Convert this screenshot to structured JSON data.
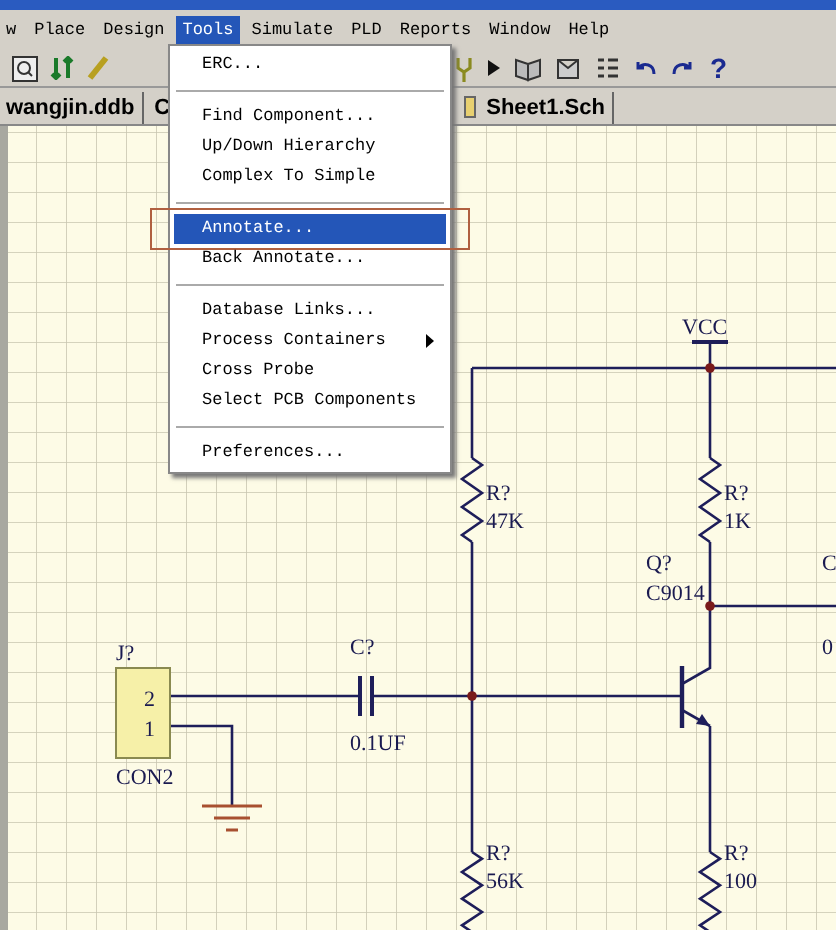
{
  "menubar": [
    {
      "label": "w",
      "selected": false
    },
    {
      "label": "Place",
      "selected": false
    },
    {
      "label": "Design",
      "selected": false
    },
    {
      "label": "Tools",
      "selected": true
    },
    {
      "label": "Simulate",
      "selected": false
    },
    {
      "label": "PLD",
      "selected": false
    },
    {
      "label": "Reports",
      "selected": false
    },
    {
      "label": "Window",
      "selected": false
    },
    {
      "label": "Help",
      "selected": false
    }
  ],
  "toolbar": {
    "help": "?"
  },
  "document_tabs": [
    {
      "label": "wangjin.ddb"
    },
    {
      "label": "C"
    },
    {
      "label": "Sheet1.Sch"
    }
  ],
  "tools_menu": [
    {
      "kind": "item",
      "label": "ERC...",
      "selected": false,
      "submenu": false,
      "framed": false
    },
    {
      "kind": "separator"
    },
    {
      "kind": "item",
      "label": "Find Component...",
      "selected": false,
      "submenu": false,
      "framed": false
    },
    {
      "kind": "item",
      "label": "Up/Down Hierarchy",
      "selected": false,
      "submenu": false,
      "framed": false
    },
    {
      "kind": "item",
      "label": "Complex To Simple",
      "selected": false,
      "submenu": false,
      "framed": false
    },
    {
      "kind": "separator"
    },
    {
      "kind": "item",
      "label": "Annotate...",
      "selected": true,
      "submenu": false,
      "framed": true
    },
    {
      "kind": "item",
      "label": "Back Annotate...",
      "selected": false,
      "submenu": false,
      "framed": false
    },
    {
      "kind": "separator"
    },
    {
      "kind": "item",
      "label": "Database Links...",
      "selected": false,
      "submenu": false,
      "framed": false
    },
    {
      "kind": "item",
      "label": "Process Containers",
      "selected": false,
      "submenu": true,
      "framed": false
    },
    {
      "kind": "item",
      "label": "Cross Probe",
      "selected": false,
      "submenu": false,
      "framed": false
    },
    {
      "kind": "item",
      "label": "Select PCB Components",
      "selected": false,
      "submenu": false,
      "framed": false
    },
    {
      "kind": "separator"
    },
    {
      "kind": "item",
      "label": "Preferences...",
      "selected": false,
      "submenu": false,
      "framed": false
    }
  ],
  "schematic": {
    "power_port": {
      "name": "VCC"
    },
    "resistors": [
      {
        "designator": "R?",
        "value": "47K"
      },
      {
        "designator": "R?",
        "value": "1K"
      },
      {
        "designator": "R?",
        "value": "56K"
      },
      {
        "designator": "R?",
        "value": "100"
      }
    ],
    "transistor": {
      "designator": "Q?",
      "value": "C9014"
    },
    "capacitor": {
      "designator": "C?",
      "value": "0.1UF"
    },
    "connector": {
      "designator": "J?",
      "value": "CON2",
      "pins": [
        "2",
        "1"
      ]
    },
    "cut_off_part": {
      "designator": "C",
      "value": "0"
    }
  }
}
